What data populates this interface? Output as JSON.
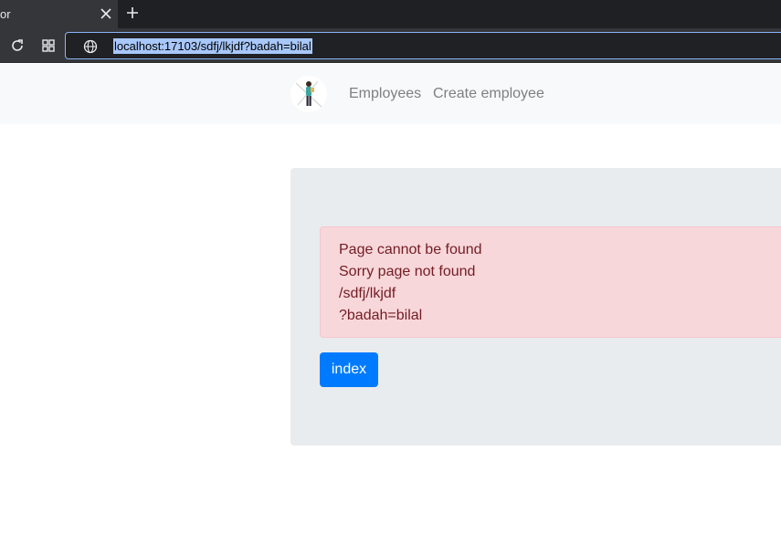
{
  "browser": {
    "tab_title": "or",
    "url": "localhost:17103/sdfj/lkjdf?badah=bilal"
  },
  "nav": {
    "links": [
      "Employees",
      "Create employee"
    ]
  },
  "error": {
    "lines": [
      "Page cannot be found",
      "Sorry page not found",
      "/sdfj/lkjdf",
      "?badah=bilal"
    ]
  },
  "button": {
    "label": "index"
  },
  "colors": {
    "primary": "#007bff",
    "alert_bg": "#f8d7da",
    "alert_text": "#721c24",
    "jumbotron": "#e9ecef",
    "navbar": "#f8f9fa"
  }
}
